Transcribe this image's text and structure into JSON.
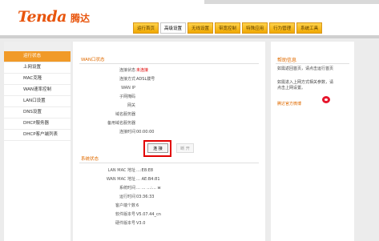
{
  "header": {
    "logo": "Tenda",
    "logo_cn": "腾达",
    "nav_tabs": [
      "运行首页",
      "高级设置",
      "无线设置",
      "带宽控制",
      "特殊应用",
      "行为管理",
      "系统工具"
    ],
    "active_tab": "高级设置"
  },
  "sidebar": {
    "items": [
      {
        "label": "运行状态",
        "active": true
      },
      {
        "label": "上网设置",
        "active": false
      },
      {
        "label": "MAC克隆",
        "active": false
      },
      {
        "label": "WAN速率控制",
        "active": false
      },
      {
        "label": "LAN口设置",
        "active": false
      },
      {
        "label": "DNS设置",
        "active": false
      },
      {
        "label": "DHCP服务器",
        "active": false
      },
      {
        "label": "DHCP客户端列表",
        "active": false
      }
    ]
  },
  "main": {
    "wan_title": "WAN口状态",
    "wan_rows": [
      {
        "label": "连接状态",
        "value": "未连接"
      },
      {
        "label": "连接方式",
        "value": "ADSL拨号"
      },
      {
        "label": "WAN IP",
        "value": ""
      },
      {
        "label": "子网掩码",
        "value": ""
      },
      {
        "label": "网关",
        "value": ""
      },
      {
        "label": "域名服务器",
        "value": ""
      },
      {
        "label": "备用域名服务器",
        "value": ""
      },
      {
        "label": "连接时间",
        "value": "00:00:00"
      }
    ],
    "connect_button": "连 接",
    "disconnect_button": "断 开",
    "sys_title": "系统状态",
    "sys_rows": [
      {
        "label": "LAN MAC 地址",
        "value": "…:E8:E8"
      },
      {
        "label": "WAN MAC 地址",
        "value": "…    AE:B4:81"
      },
      {
        "label": "系统时间",
        "value": "…  …  …:… w"
      },
      {
        "label": "运行时间",
        "value": "03:36:33"
      },
      {
        "label": "客户端个数",
        "value": "6"
      },
      {
        "label": "软件版本号",
        "value": "V5.07.44_cn"
      },
      {
        "label": "硬件版本号",
        "value": "V3.0"
      }
    ]
  },
  "help": {
    "title": "帮助信息",
    "paragraphs": [
      "如需返回首页，请点击运行首页",
      "如需进入上网方式相关参数，请点击上网设置。"
    ],
    "link": "腾达官方微博"
  },
  "colors": {
    "brand": "#e8550d",
    "accent": "#f19a28",
    "alert": "#e20000"
  }
}
